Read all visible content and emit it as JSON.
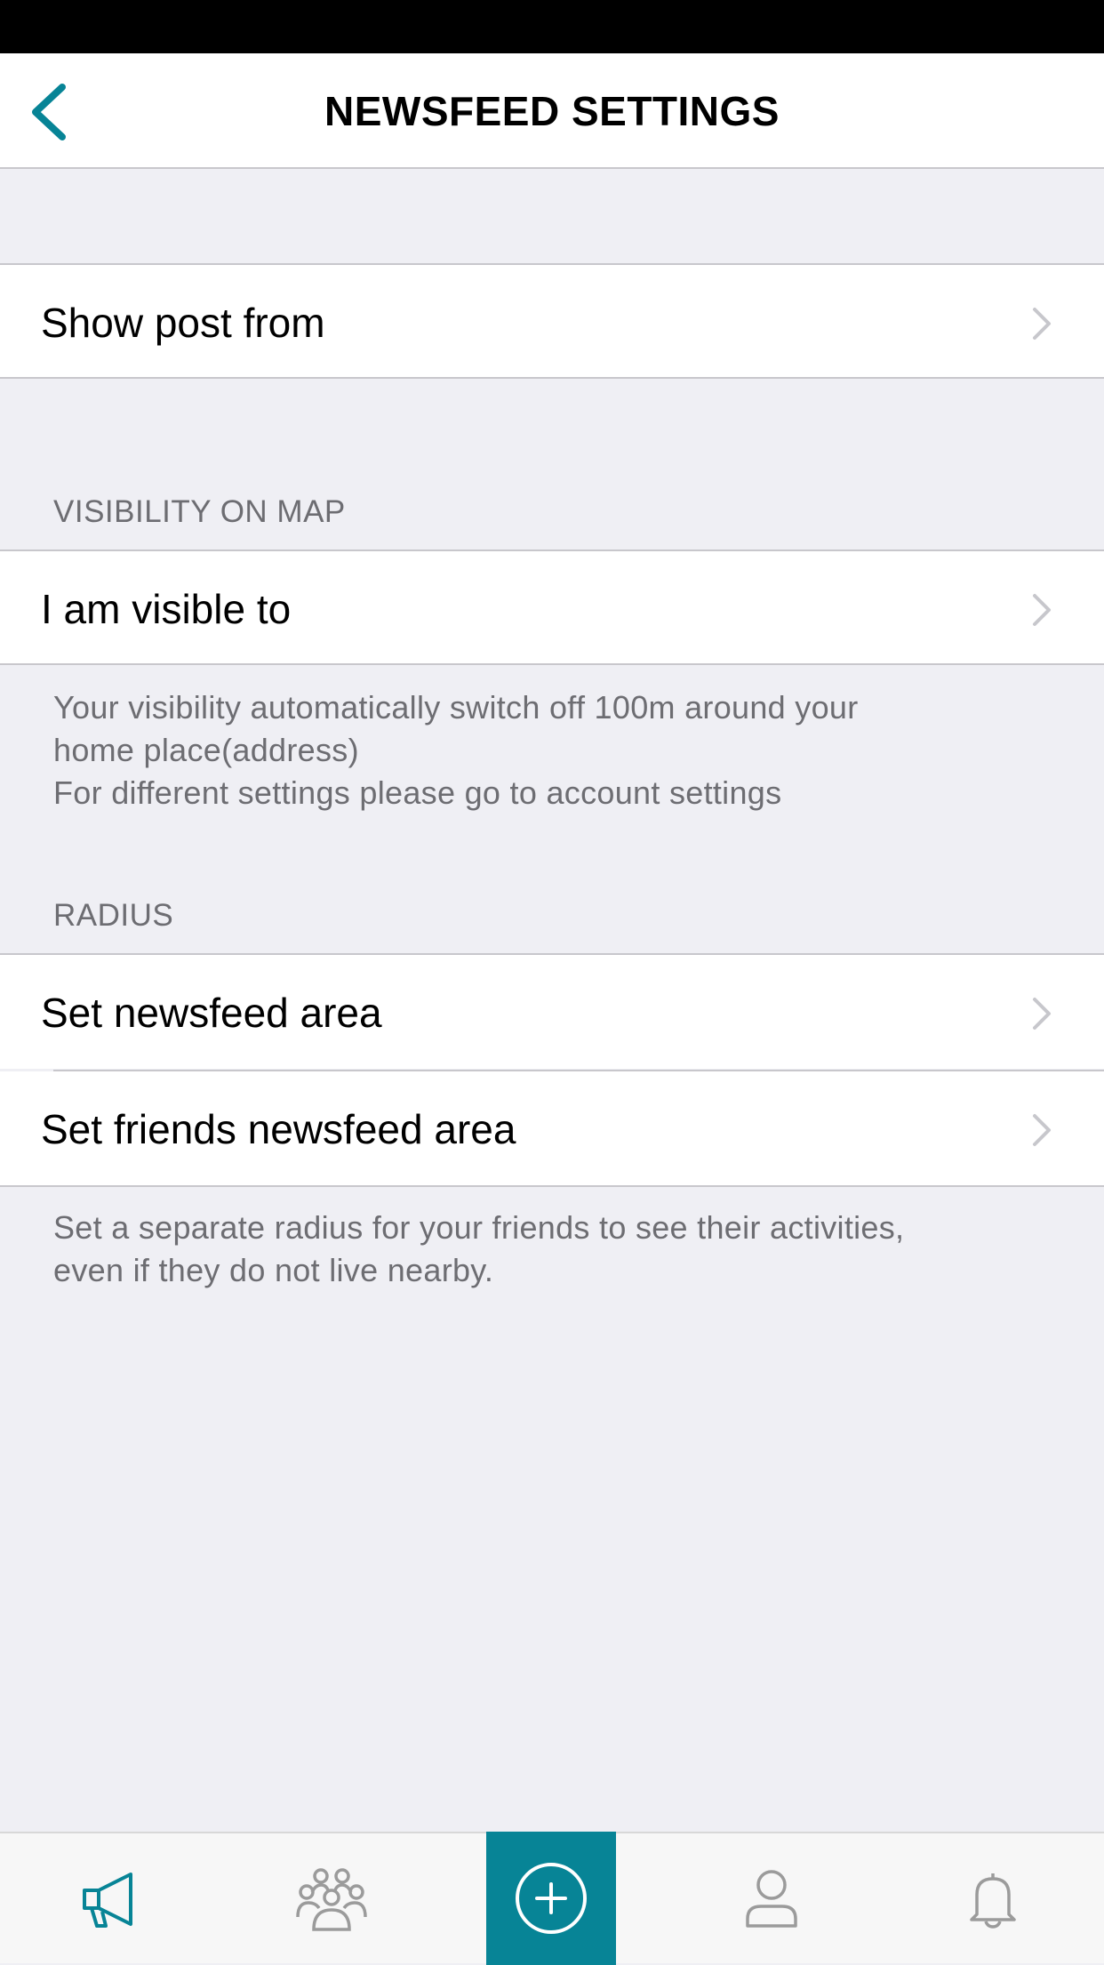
{
  "nav": {
    "title": "NEWSFEED SETTINGS"
  },
  "rows": {
    "show_post_from": "Show post from",
    "visible_to": "I am visible to",
    "set_newsfeed_area": "Set newsfeed area",
    "set_friends_newsfeed_area": "Set friends newsfeed area"
  },
  "sections": {
    "visibility_header": "VISIBILITY ON MAP",
    "radius_header": "RADIUS"
  },
  "footers": {
    "visibility_line1": "Your visibility automatically switch off 100m around your",
    "visibility_line2": "home place(address)",
    "visibility_line3": "For different settings please go to account settings",
    "radius_line1": "Set a separate radius for your friends to see their activities,",
    "radius_line2": "even if they do not live nearby."
  },
  "tabbar": {
    "tabs": [
      "megaphone-icon",
      "group-icon",
      "add-icon",
      "profile-icon",
      "bell-icon"
    ]
  },
  "colors": {
    "accent": "#078496",
    "background": "#efeff4",
    "secondary_text": "#6d6d72"
  }
}
